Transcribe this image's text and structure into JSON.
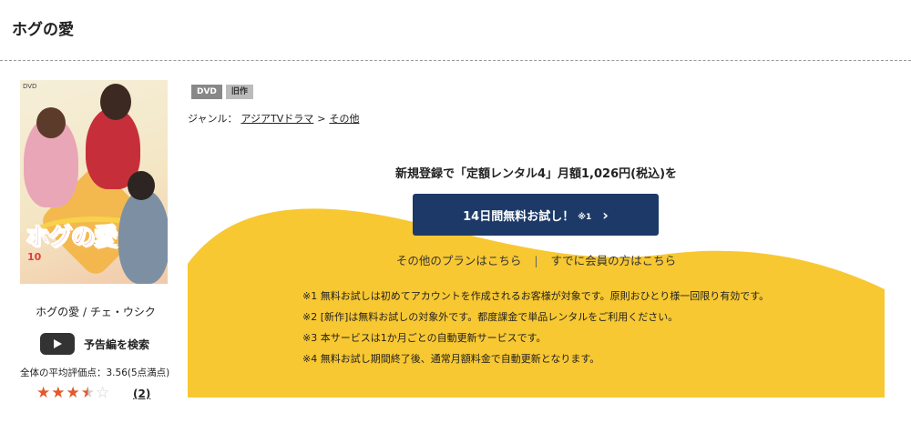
{
  "page": {
    "title": "ホグの愛"
  },
  "cover": {
    "alt": "ホグの愛 DVD cover",
    "title_art": "ホグの愛",
    "vol": "10",
    "dvd_mark": "DVD"
  },
  "product": {
    "caption": "ホグの愛 / チェ・ウシク",
    "trailer_label": "予告編を検索",
    "avg_rating_text": "全体の平均評価点：3.56(5点満点)",
    "rating_value": 3.56,
    "rating_max": 5,
    "review_count": "(2)"
  },
  "badges": [
    "DVD",
    "旧作"
  ],
  "genre": {
    "label": "ジャンル：",
    "items": [
      "アジアTVドラマ",
      "その他"
    ],
    "separator": ">"
  },
  "promo": {
    "headline": "新規登録で「定額レンタル4」月額1,026円(税込)を",
    "cta_label": "14日間無料お試し！",
    "cta_note": "※1",
    "cta_chevron": "›",
    "link_other_plans": "その他のプランはこちら",
    "link_separator": "|",
    "link_members": "すでに会員の方はこちら",
    "notes": [
      "※1 無料お試しは初めてアカウントを作成されるお客様が対象です。原則おひとり様一回限り有効です。",
      "※2 [新作]は無料お試しの対象外です。都度課金で単品レンタルをご利用ください。",
      "※3 本サービスは1か月ごとの自動更新サービスです。",
      "※4 無料お試し期間終了後、通常月額料金で自動更新となります。"
    ]
  },
  "colors": {
    "cta_bg": "#1c3967",
    "promo_yellow": "#f8c832",
    "star": "#e05a2b"
  }
}
